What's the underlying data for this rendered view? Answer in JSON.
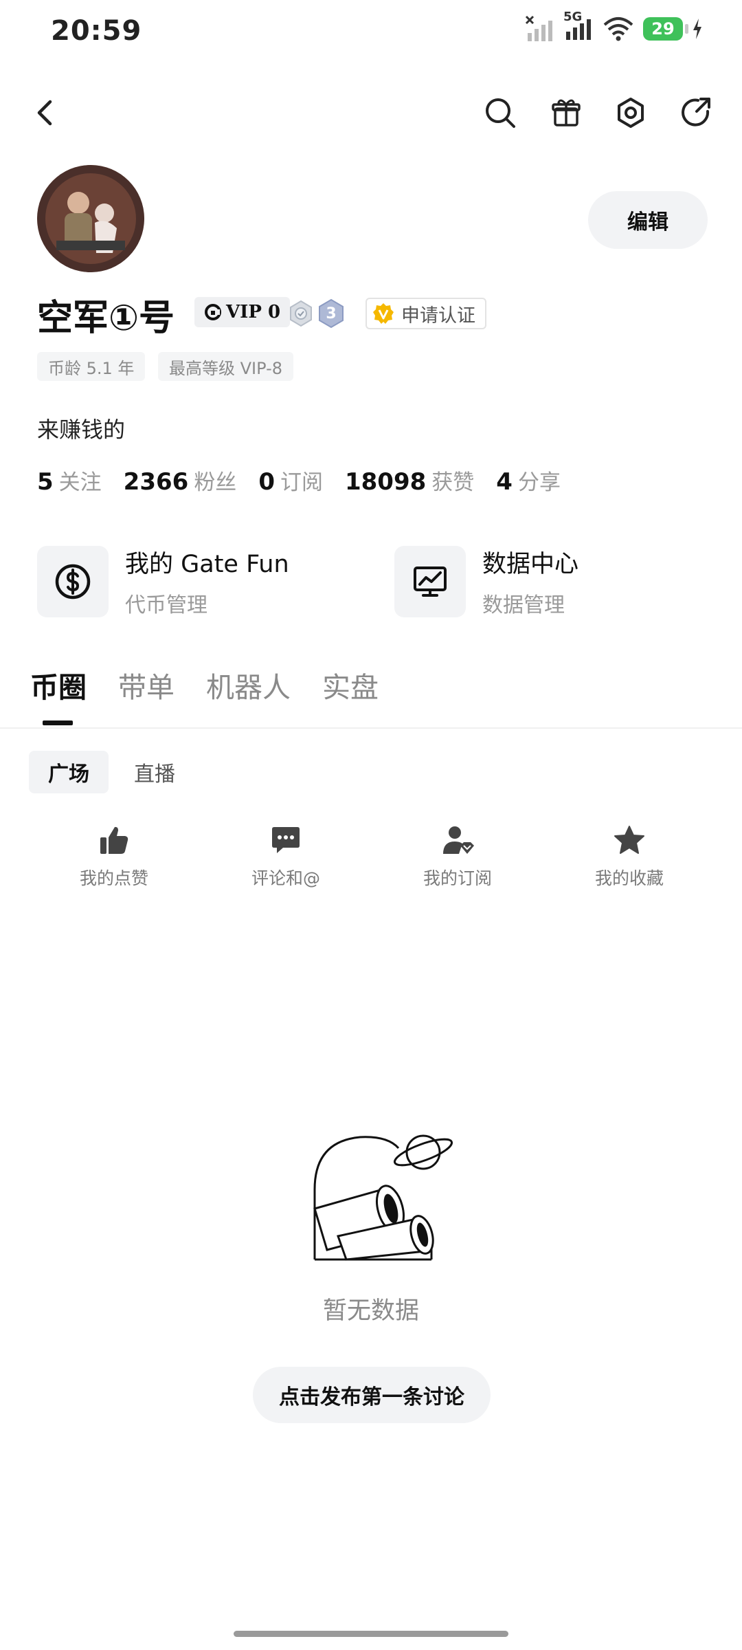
{
  "status_bar": {
    "time": "20:59",
    "network": "5G",
    "battery": "29"
  },
  "profile": {
    "name": "空军①号",
    "vip": "VIP 0",
    "medal_level": "3",
    "cert": "申请认证",
    "edit_label": "编辑",
    "tags": [
      "币龄 5.1 年",
      "最高等级 VIP-8"
    ],
    "bio": "来赚钱的"
  },
  "stats": [
    {
      "num": "5",
      "label": "关注"
    },
    {
      "num": "2366",
      "label": "粉丝"
    },
    {
      "num": "0",
      "label": "订阅"
    },
    {
      "num": "18098",
      "label": "获赞"
    },
    {
      "num": "4",
      "label": "分享"
    }
  ],
  "cards": [
    {
      "title": "我的 Gate Fun",
      "sub": "代币管理",
      "icon": "dollar-icon"
    },
    {
      "title": "数据中心",
      "sub": "数据管理",
      "icon": "chart-icon"
    }
  ],
  "tabs": [
    "币圈",
    "带单",
    "机器人",
    "实盘"
  ],
  "sub_tabs": [
    "广场",
    "直播"
  ],
  "shortcuts": [
    {
      "label": "我的点赞",
      "icon": "thumbs-up-icon"
    },
    {
      "label": "评论和@",
      "icon": "comment-icon"
    },
    {
      "label": "我的订阅",
      "icon": "subscription-icon"
    },
    {
      "label": "我的收藏",
      "icon": "star-icon"
    }
  ],
  "empty_state": {
    "text": "暂无数据",
    "cta": "点击发布第一条讨论"
  },
  "colors": {
    "accent": "#111111",
    "muted": "#9a9a9a",
    "chip_bg": "#f2f3f5",
    "battery": "#3fc15a",
    "cert_gold": "#f5b800"
  }
}
